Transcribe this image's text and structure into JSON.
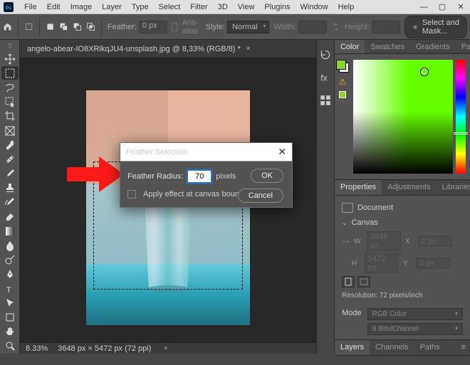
{
  "menubar": {
    "items": [
      "File",
      "Edit",
      "Image",
      "Layer",
      "Type",
      "Select",
      "Filter",
      "3D",
      "View",
      "Plugins",
      "Window",
      "Help"
    ]
  },
  "winctrl": {
    "min": "—",
    "max": "▢",
    "close": "✕"
  },
  "options": {
    "feather_label": "Feather:",
    "feather_value": "0 px",
    "antialias_label": "Anti-alias",
    "style_label": "Style:",
    "style_value": "Normal",
    "width_label": "Width:",
    "height_label": "Height:",
    "mask_btn": "Select and Mask..."
  },
  "document": {
    "tab": "angelo-abear-IO8XRikqJU4-unsplash.jpg @ 8,33% (RGB/8) *",
    "tab_close": "×"
  },
  "status": {
    "zoom": "8.33%",
    "info": "3648 px × 5472 px (72 ppi)",
    "arrow": ">"
  },
  "color_panel": {
    "tabs": [
      "Color",
      "Swatches",
      "Gradients",
      "Patterns"
    ]
  },
  "properties_panel": {
    "tabs": [
      "Properties",
      "Adjustments",
      "Libraries"
    ],
    "doc_label": "Document",
    "canvas_label": "Canvas",
    "w_label": "W",
    "w_val": "3648 px",
    "x_label": "X",
    "x_val": "0 px",
    "h_label": "H",
    "h_val": "5472 px",
    "y_label": "Y",
    "y_val": "0 px",
    "resolution": "Resolution: 72 pixels/inch",
    "mode_label": "Mode",
    "mode_val": "RGB Color",
    "depth_val": "8 Bits/Channel"
  },
  "layers_panel": {
    "tabs": [
      "Layers",
      "Channels",
      "Paths"
    ]
  },
  "dialog": {
    "title": "Feather Selection",
    "radius_label": "Feather Radius:",
    "radius_value": "70",
    "pixels_label": "pixels",
    "bounds_label": "Apply effect at canvas bounds",
    "ok": "OK",
    "cancel": "Cancel"
  }
}
